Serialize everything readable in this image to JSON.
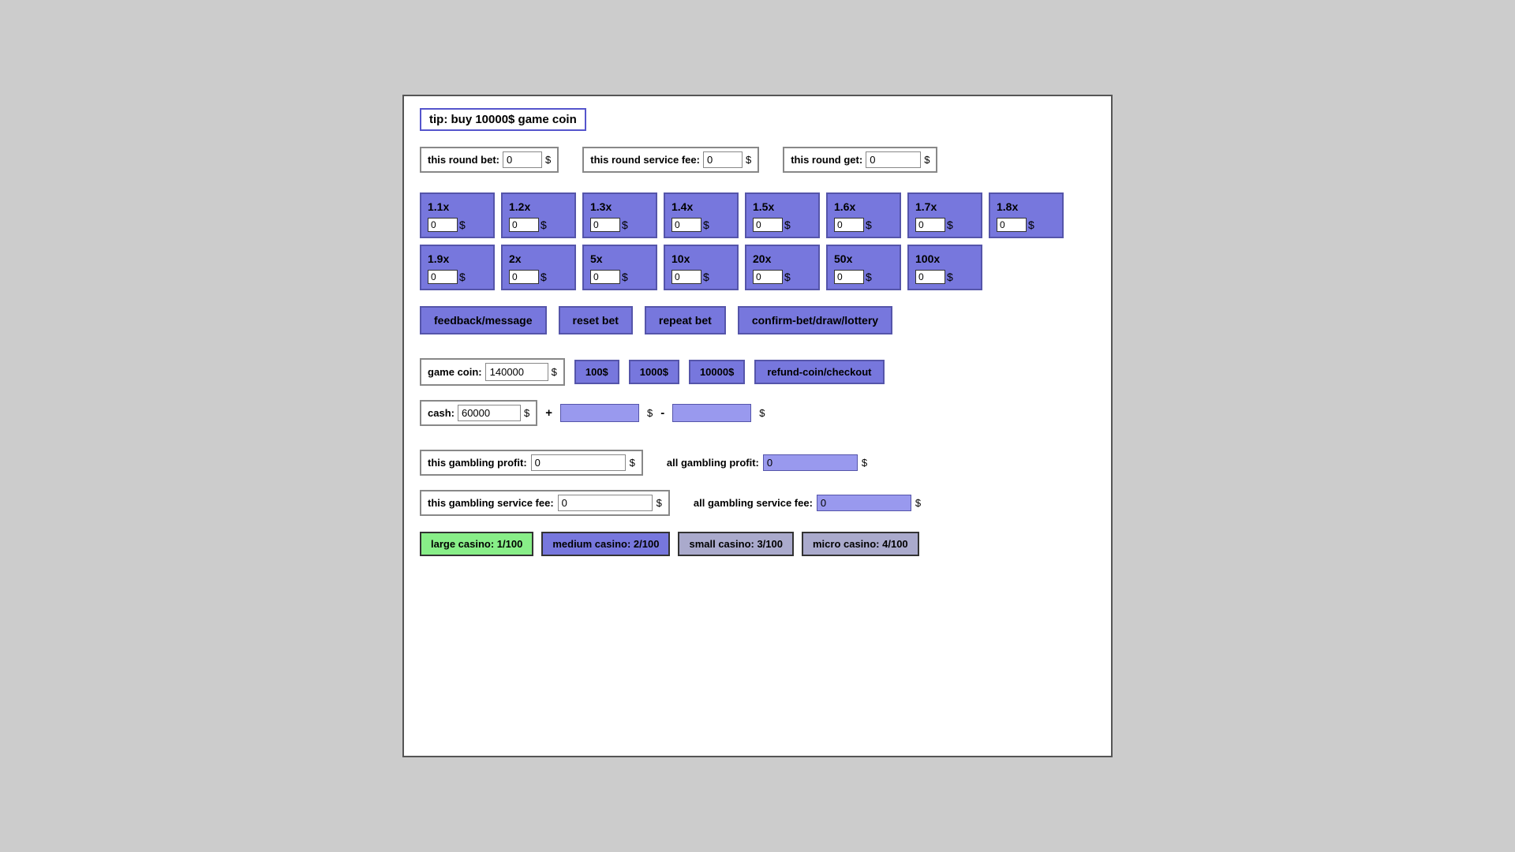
{
  "tip": {
    "text": "tip: buy 10000$ game coin"
  },
  "roundInfo": {
    "bet_label": "this round bet:",
    "bet_value": "0",
    "fee_label": "this round service fee:",
    "fee_value": "0",
    "get_label": "this round get:",
    "get_value": "0",
    "dollar": "$"
  },
  "multipliers": [
    {
      "label": "1.1x",
      "value": "0"
    },
    {
      "label": "1.2x",
      "value": "0"
    },
    {
      "label": "1.3x",
      "value": "0"
    },
    {
      "label": "1.4x",
      "value": "0"
    },
    {
      "label": "1.5x",
      "value": "0"
    },
    {
      "label": "1.6x",
      "value": "0"
    },
    {
      "label": "1.7x",
      "value": "0"
    },
    {
      "label": "1.8x",
      "value": "0"
    },
    {
      "label": "1.9x",
      "value": "0"
    },
    {
      "label": "2x",
      "value": "0"
    },
    {
      "label": "5x",
      "value": "0"
    },
    {
      "label": "10x",
      "value": "0"
    },
    {
      "label": "20x",
      "value": "0"
    },
    {
      "label": "50x",
      "value": "0"
    },
    {
      "label": "100x",
      "value": "0"
    }
  ],
  "actions": {
    "feedback": "feedback/message",
    "reset": "reset bet",
    "repeat": "repeat bet",
    "confirm": "confirm-bet/draw/lottery"
  },
  "gameCoin": {
    "label": "game coin:",
    "value": "140000",
    "dollar": "$",
    "btn100": "100$",
    "btn1000": "1000$",
    "btn10000": "10000$",
    "checkout": "refund-coin/checkout"
  },
  "cash": {
    "label": "cash:",
    "value": "60000",
    "dollar": "$",
    "plus": "+",
    "minus": "-"
  },
  "profit": {
    "this_profit_label": "this gambling profit:",
    "this_profit_value": "0",
    "all_profit_label": "all gambling profit:",
    "all_profit_value": "0",
    "dollar": "$",
    "this_fee_label": "this gambling service fee:",
    "this_fee_value": "0",
    "all_fee_label": "all gambling service fee:",
    "all_fee_value": "0"
  },
  "casinos": [
    {
      "label": "large casino: 1/100",
      "style": "green"
    },
    {
      "label": "medium casino: 2/100",
      "style": "blue"
    },
    {
      "label": "small casino: 3/100",
      "style": "gray"
    },
    {
      "label": "micro casino: 4/100",
      "style": "gray"
    }
  ]
}
